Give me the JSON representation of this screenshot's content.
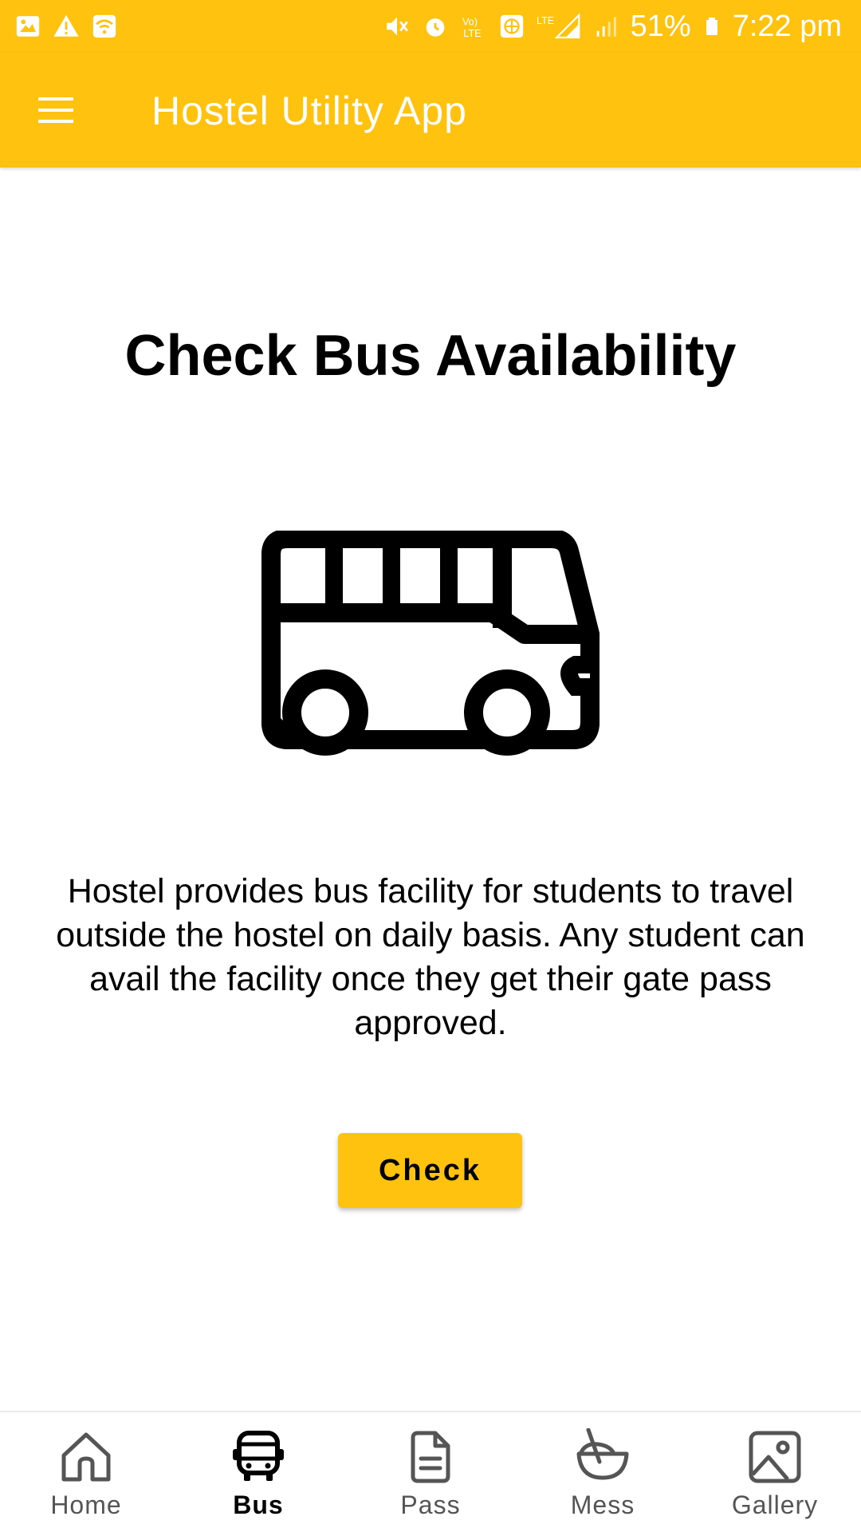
{
  "status_bar": {
    "battery": "51%",
    "time": "7:22 pm"
  },
  "app_bar": {
    "title": "Hostel Utility App"
  },
  "main": {
    "heading": "Check Bus Availability",
    "description": "Hostel provides bus facility for students to travel outside the hostel on daily basis. Any student can avail the facility once they get their gate pass approved.",
    "check_label": "Check"
  },
  "bottom_nav": {
    "items": [
      {
        "label": "Home",
        "icon": "home-icon",
        "active": false
      },
      {
        "label": "Bus",
        "icon": "bus-icon",
        "active": true
      },
      {
        "label": "Pass",
        "icon": "document-icon",
        "active": false
      },
      {
        "label": "Mess",
        "icon": "bowl-icon",
        "active": false
      },
      {
        "label": "Gallery",
        "icon": "image-icon",
        "active": false
      }
    ]
  },
  "colors": {
    "accent": "#FEC20F",
    "text": "#000000",
    "inactive": "#555555"
  }
}
